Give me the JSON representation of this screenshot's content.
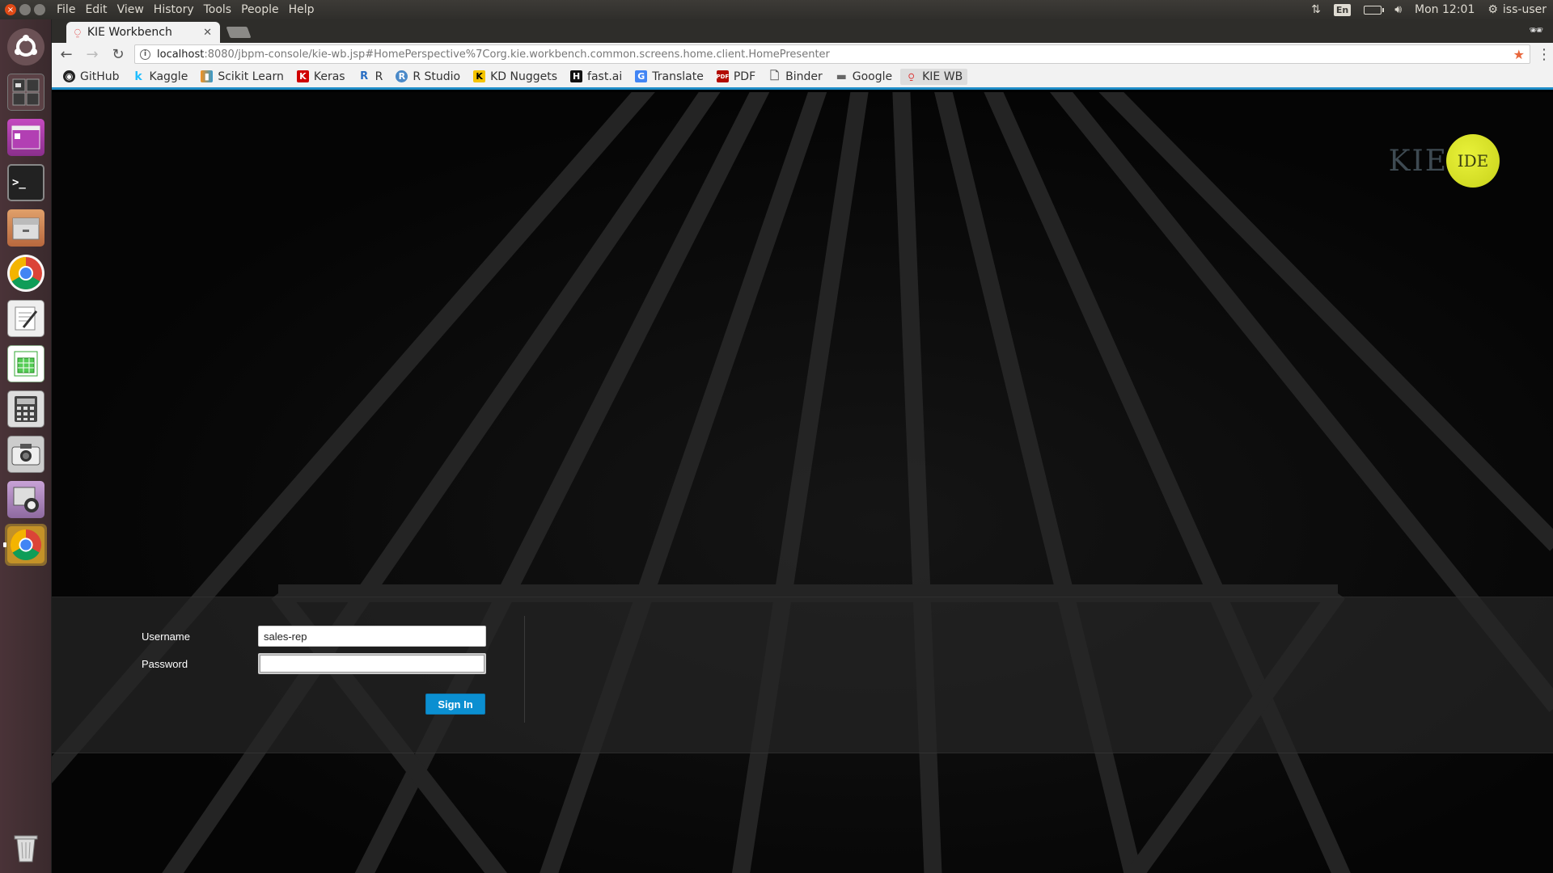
{
  "system": {
    "menu": [
      "File",
      "Edit",
      "View",
      "History",
      "Tools",
      "People",
      "Help"
    ],
    "keyboard": "En",
    "clock": "Mon 12:01",
    "user": "iss-user"
  },
  "launcher": {
    "apps": [
      "ubuntu-dash",
      "workspace-switcher",
      "app-launcher",
      "terminal",
      "files",
      "chrome",
      "text-editor",
      "spreadsheet",
      "calculator",
      "screenshot",
      "webcam",
      "chrome-active",
      "trash"
    ]
  },
  "browser": {
    "tab_title": "KIE Workbench",
    "url_host": "localhost",
    "url_rest": ":8080/jbpm-console/kie-wb.jsp#HomePerspective%7Corg.kie.workbench.common.screens.home.client.HomePresenter",
    "bookmarks": [
      {
        "label": "GitHub",
        "icon": "github-icon"
      },
      {
        "label": "Kaggle",
        "icon": "kaggle-icon"
      },
      {
        "label": "Scikit Learn",
        "icon": "scikit-learn-icon"
      },
      {
        "label": "Keras",
        "icon": "keras-icon"
      },
      {
        "label": "R",
        "icon": "r-icon"
      },
      {
        "label": "R Studio",
        "icon": "rstudio-icon"
      },
      {
        "label": "KD Nuggets",
        "icon": "kdnuggets-icon"
      },
      {
        "label": "fast.ai",
        "icon": "fastai-icon"
      },
      {
        "label": "Translate",
        "icon": "translate-icon"
      },
      {
        "label": "PDF",
        "icon": "pdf-icon"
      },
      {
        "label": "Binder",
        "icon": "document-icon"
      },
      {
        "label": "Google",
        "icon": "folder-icon"
      },
      {
        "label": "KIE WB",
        "icon": "kie-icon"
      }
    ]
  },
  "page": {
    "logo_kie": "KIE",
    "logo_ide": "IDE",
    "username_label": "Username",
    "username_value": "sales-rep",
    "password_label": "Password",
    "password_value": "",
    "signin_label": "Sign In"
  }
}
